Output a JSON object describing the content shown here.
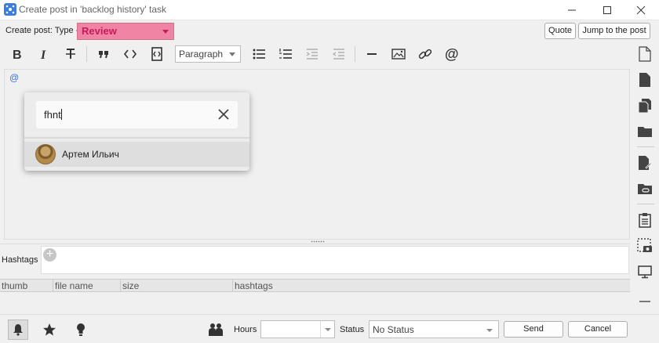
{
  "window": {
    "title": "Create post in 'backlog history' task",
    "minimize_icon": "minimize-icon",
    "maximize_icon": "maximize-icon",
    "close_icon": "close-icon"
  },
  "header": {
    "type_label": "Create post: Type -",
    "type_value": "Review",
    "type_color": "#ef84a5",
    "quote_label": "Quote",
    "jump_label": "Jump to the post"
  },
  "toolbar": {
    "paragraph_value": "Paragraph",
    "icons": [
      "bold-icon",
      "italic-icon",
      "strikethrough-icon",
      "blockquote-icon",
      "code-icon",
      "code-block-icon",
      "bullet-list-icon",
      "numbered-list-icon",
      "indent-icon",
      "outdent-icon",
      "horizontal-rule-icon",
      "image-icon",
      "link-icon",
      "mention-icon"
    ]
  },
  "editor": {
    "content": "@"
  },
  "mention_popup": {
    "search_value": "fhnt",
    "results": [
      {
        "name": "Артем Ильич"
      }
    ]
  },
  "hashtags": {
    "label": "Hashtags",
    "add_symbol": "+"
  },
  "attachments_table": {
    "columns": [
      "thumb",
      "file name",
      "size",
      "hashtags"
    ]
  },
  "footer": {
    "hours_label": "Hours",
    "hours_value": "",
    "status_label": "Status",
    "status_value": "No Status",
    "send_label": "Send",
    "cancel_label": "Cancel"
  },
  "right_panel": {
    "icons": [
      "new-document-icon",
      "document-icon",
      "documents-icon",
      "folder-icon",
      "document-edit-icon",
      "folder-link-icon",
      "clipboard-icon",
      "screenshot-icon",
      "monitor-icon",
      "collapse-icon"
    ]
  }
}
